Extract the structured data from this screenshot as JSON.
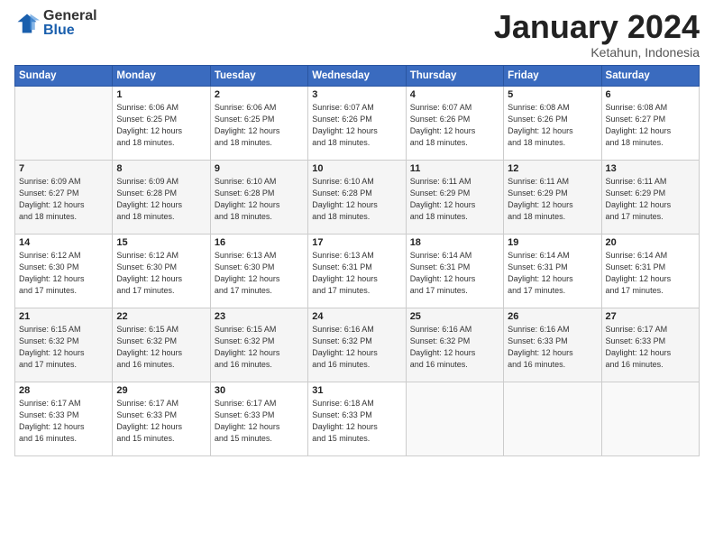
{
  "header": {
    "logo_general": "General",
    "logo_blue": "Blue",
    "month_title": "January 2024",
    "location": "Ketahun, Indonesia"
  },
  "weekdays": [
    "Sunday",
    "Monday",
    "Tuesday",
    "Wednesday",
    "Thursday",
    "Friday",
    "Saturday"
  ],
  "weeks": [
    [
      {
        "day": "",
        "sunrise": "",
        "sunset": "",
        "daylight": ""
      },
      {
        "day": "1",
        "sunrise": "6:06 AM",
        "sunset": "6:25 PM",
        "daylight": "12 hours and 18 minutes."
      },
      {
        "day": "2",
        "sunrise": "6:06 AM",
        "sunset": "6:25 PM",
        "daylight": "12 hours and 18 minutes."
      },
      {
        "day": "3",
        "sunrise": "6:07 AM",
        "sunset": "6:26 PM",
        "daylight": "12 hours and 18 minutes."
      },
      {
        "day": "4",
        "sunrise": "6:07 AM",
        "sunset": "6:26 PM",
        "daylight": "12 hours and 18 minutes."
      },
      {
        "day": "5",
        "sunrise": "6:08 AM",
        "sunset": "6:26 PM",
        "daylight": "12 hours and 18 minutes."
      },
      {
        "day": "6",
        "sunrise": "6:08 AM",
        "sunset": "6:27 PM",
        "daylight": "12 hours and 18 minutes."
      }
    ],
    [
      {
        "day": "7",
        "sunrise": "6:09 AM",
        "sunset": "6:27 PM",
        "daylight": "12 hours and 18 minutes."
      },
      {
        "day": "8",
        "sunrise": "6:09 AM",
        "sunset": "6:28 PM",
        "daylight": "12 hours and 18 minutes."
      },
      {
        "day": "9",
        "sunrise": "6:10 AM",
        "sunset": "6:28 PM",
        "daylight": "12 hours and 18 minutes."
      },
      {
        "day": "10",
        "sunrise": "6:10 AM",
        "sunset": "6:28 PM",
        "daylight": "12 hours and 18 minutes."
      },
      {
        "day": "11",
        "sunrise": "6:11 AM",
        "sunset": "6:29 PM",
        "daylight": "12 hours and 18 minutes."
      },
      {
        "day": "12",
        "sunrise": "6:11 AM",
        "sunset": "6:29 PM",
        "daylight": "12 hours and 18 minutes."
      },
      {
        "day": "13",
        "sunrise": "6:11 AM",
        "sunset": "6:29 PM",
        "daylight": "12 hours and 17 minutes."
      }
    ],
    [
      {
        "day": "14",
        "sunrise": "6:12 AM",
        "sunset": "6:30 PM",
        "daylight": "12 hours and 17 minutes."
      },
      {
        "day": "15",
        "sunrise": "6:12 AM",
        "sunset": "6:30 PM",
        "daylight": "12 hours and 17 minutes."
      },
      {
        "day": "16",
        "sunrise": "6:13 AM",
        "sunset": "6:30 PM",
        "daylight": "12 hours and 17 minutes."
      },
      {
        "day": "17",
        "sunrise": "6:13 AM",
        "sunset": "6:31 PM",
        "daylight": "12 hours and 17 minutes."
      },
      {
        "day": "18",
        "sunrise": "6:14 AM",
        "sunset": "6:31 PM",
        "daylight": "12 hours and 17 minutes."
      },
      {
        "day": "19",
        "sunrise": "6:14 AM",
        "sunset": "6:31 PM",
        "daylight": "12 hours and 17 minutes."
      },
      {
        "day": "20",
        "sunrise": "6:14 AM",
        "sunset": "6:31 PM",
        "daylight": "12 hours and 17 minutes."
      }
    ],
    [
      {
        "day": "21",
        "sunrise": "6:15 AM",
        "sunset": "6:32 PM",
        "daylight": "12 hours and 17 minutes."
      },
      {
        "day": "22",
        "sunrise": "6:15 AM",
        "sunset": "6:32 PM",
        "daylight": "12 hours and 16 minutes."
      },
      {
        "day": "23",
        "sunrise": "6:15 AM",
        "sunset": "6:32 PM",
        "daylight": "12 hours and 16 minutes."
      },
      {
        "day": "24",
        "sunrise": "6:16 AM",
        "sunset": "6:32 PM",
        "daylight": "12 hours and 16 minutes."
      },
      {
        "day": "25",
        "sunrise": "6:16 AM",
        "sunset": "6:32 PM",
        "daylight": "12 hours and 16 minutes."
      },
      {
        "day": "26",
        "sunrise": "6:16 AM",
        "sunset": "6:33 PM",
        "daylight": "12 hours and 16 minutes."
      },
      {
        "day": "27",
        "sunrise": "6:17 AM",
        "sunset": "6:33 PM",
        "daylight": "12 hours and 16 minutes."
      }
    ],
    [
      {
        "day": "28",
        "sunrise": "6:17 AM",
        "sunset": "6:33 PM",
        "daylight": "12 hours and 16 minutes."
      },
      {
        "day": "29",
        "sunrise": "6:17 AM",
        "sunset": "6:33 PM",
        "daylight": "12 hours and 15 minutes."
      },
      {
        "day": "30",
        "sunrise": "6:17 AM",
        "sunset": "6:33 PM",
        "daylight": "12 hours and 15 minutes."
      },
      {
        "day": "31",
        "sunrise": "6:18 AM",
        "sunset": "6:33 PM",
        "daylight": "12 hours and 15 minutes."
      },
      {
        "day": "",
        "sunrise": "",
        "sunset": "",
        "daylight": ""
      },
      {
        "day": "",
        "sunrise": "",
        "sunset": "",
        "daylight": ""
      },
      {
        "day": "",
        "sunrise": "",
        "sunset": "",
        "daylight": ""
      }
    ]
  ],
  "labels": {
    "sunrise_prefix": "Sunrise: ",
    "sunset_prefix": "Sunset: ",
    "daylight_prefix": "Daylight: "
  }
}
